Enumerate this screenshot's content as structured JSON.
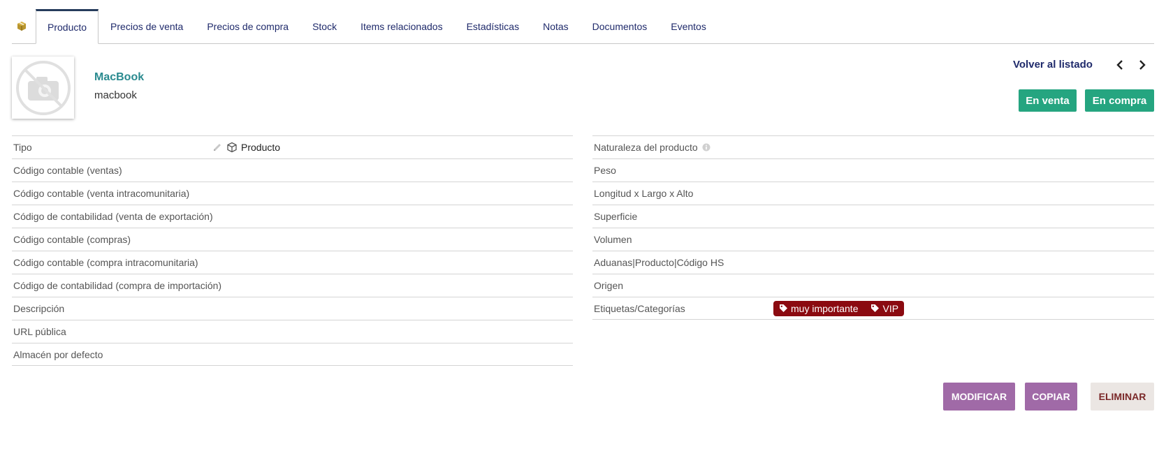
{
  "tabs": [
    {
      "label": "Producto",
      "active": true
    },
    {
      "label": "Precios de venta"
    },
    {
      "label": "Precios de compra"
    },
    {
      "label": "Stock"
    },
    {
      "label": "Items relacionados"
    },
    {
      "label": "Estadísticas"
    },
    {
      "label": "Notas"
    },
    {
      "label": "Documentos"
    },
    {
      "label": "Eventos"
    }
  ],
  "product": {
    "label": "MacBook",
    "ref": "macbook"
  },
  "nav": {
    "back_label": "Volver al listado"
  },
  "status": {
    "sell": "En venta",
    "buy": "En compra"
  },
  "left_fields": [
    {
      "label": "Tipo",
      "value": "Producto"
    },
    {
      "label": "Código contable (ventas)"
    },
    {
      "label": "Código contable (venta intracomunitaria)"
    },
    {
      "label": "Código de contabilidad (venta de exportación)"
    },
    {
      "label": "Código contable (compras)"
    },
    {
      "label": "Código contable (compra intracomunitaria)"
    },
    {
      "label": "Código de contabilidad (compra de importación)"
    },
    {
      "label": "Descripción"
    },
    {
      "label": "URL pública"
    },
    {
      "label": "Almacén por defecto"
    }
  ],
  "right_fields": [
    {
      "label": "Naturaleza del producto"
    },
    {
      "label": "Peso"
    },
    {
      "label": "Longitud x Largo x Alto"
    },
    {
      "label": "Superficie"
    },
    {
      "label": "Volumen"
    },
    {
      "label": "Aduanas|Producto|Código HS"
    },
    {
      "label": "Origen"
    },
    {
      "label": "Etiquetas/Categorías",
      "tags": [
        "muy importante",
        "VIP"
      ]
    }
  ],
  "actions": {
    "modify": "MODIFICAR",
    "copy": "COPIAR",
    "delete": "ELIMINAR"
  },
  "colors": {
    "tab_text": "#1f2a6b",
    "status_green": "#25a580",
    "tag_red": "#8b0a10",
    "button_purple": "#a06aa7"
  }
}
